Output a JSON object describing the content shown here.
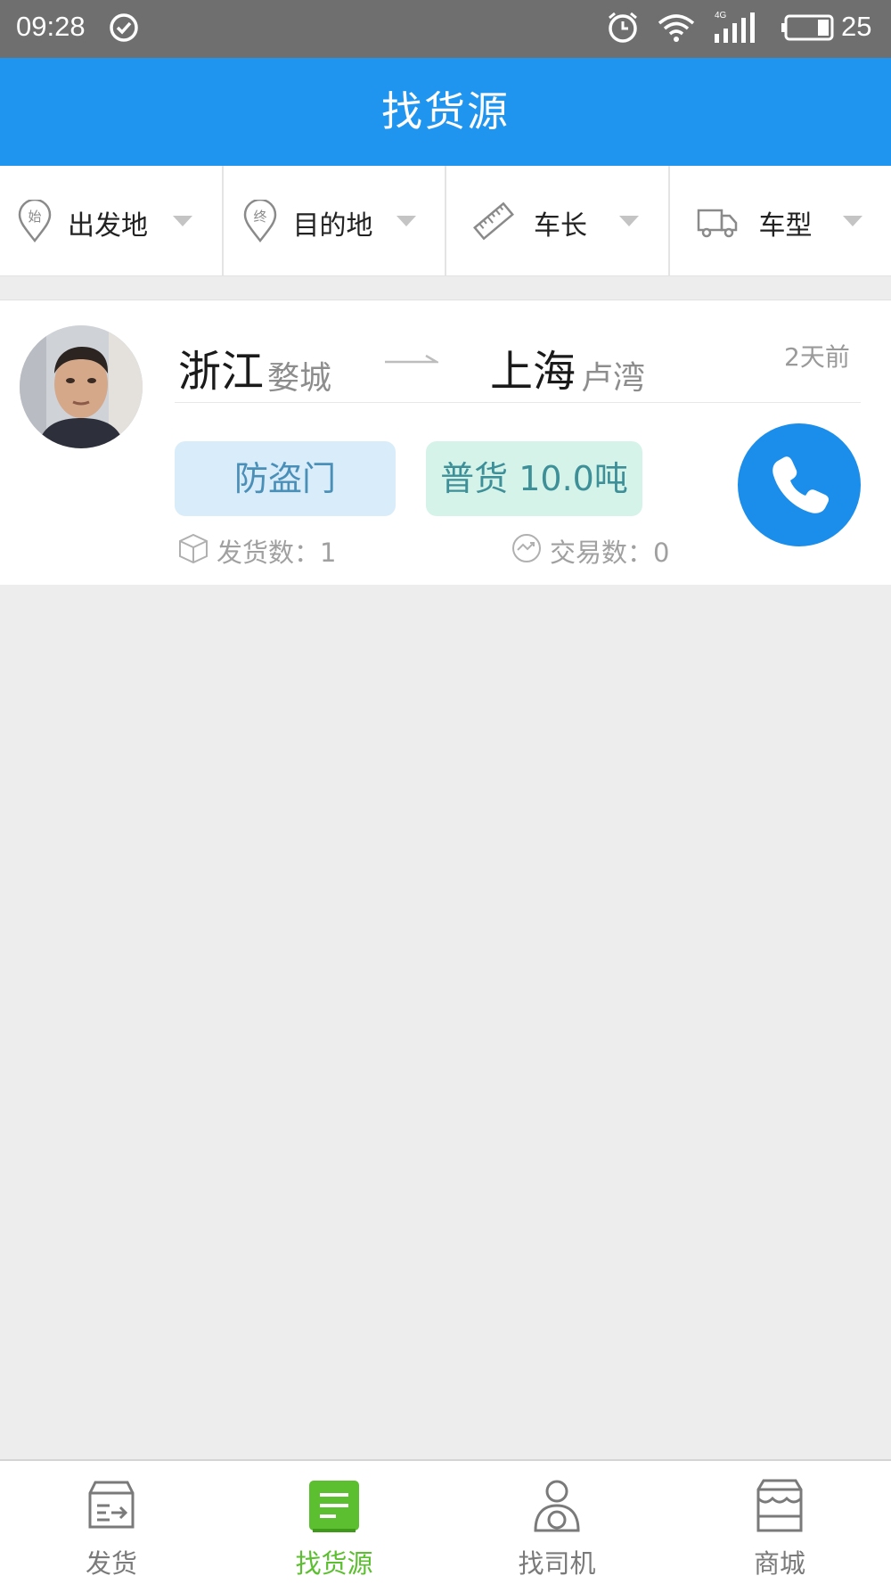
{
  "status_bar": {
    "time": "09:28",
    "network": "4G",
    "battery": "25",
    "icons": [
      "check-circle-icon",
      "alarm-icon",
      "wifi-icon",
      "signal-icon",
      "battery-icon"
    ]
  },
  "header": {
    "title": "找货源"
  },
  "filters": [
    {
      "label": "出发地",
      "icon": "origin-pin-icon",
      "icon_char": "始"
    },
    {
      "label": "目的地",
      "icon": "destination-pin-icon",
      "icon_char": "终"
    },
    {
      "label": "车长",
      "icon": "ruler-icon"
    },
    {
      "label": "车型",
      "icon": "truck-icon"
    }
  ],
  "listing": {
    "from_province": "浙江",
    "from_city": "婺城",
    "to_province": "上海",
    "to_city": "卢湾",
    "time_ago": "2天前",
    "cargo_name": "防盗门",
    "cargo_type_weight": "普货 10.0吨",
    "shipments_label": "发货数：1",
    "trades_label": "交易数：0",
    "icons": [
      "avatar",
      "arrow-right-icon",
      "phone-icon",
      "box-icon",
      "exchange-icon"
    ]
  },
  "bottom_nav": [
    {
      "label": "发货",
      "icon": "ship-box-icon",
      "active": false
    },
    {
      "label": "找货源",
      "icon": "list-icon",
      "active": true
    },
    {
      "label": "找司机",
      "icon": "driver-icon",
      "active": false
    },
    {
      "label": "商城",
      "icon": "store-icon",
      "active": false
    }
  ],
  "colors": {
    "status_bar": "#6f6f6f",
    "header": "#1f95f0",
    "call_button": "#1a8eea",
    "active_tab": "#5bbf2f",
    "cargo_tag_bg": "#d9ecf9",
    "weight_tag_bg": "#d6f3ea"
  }
}
